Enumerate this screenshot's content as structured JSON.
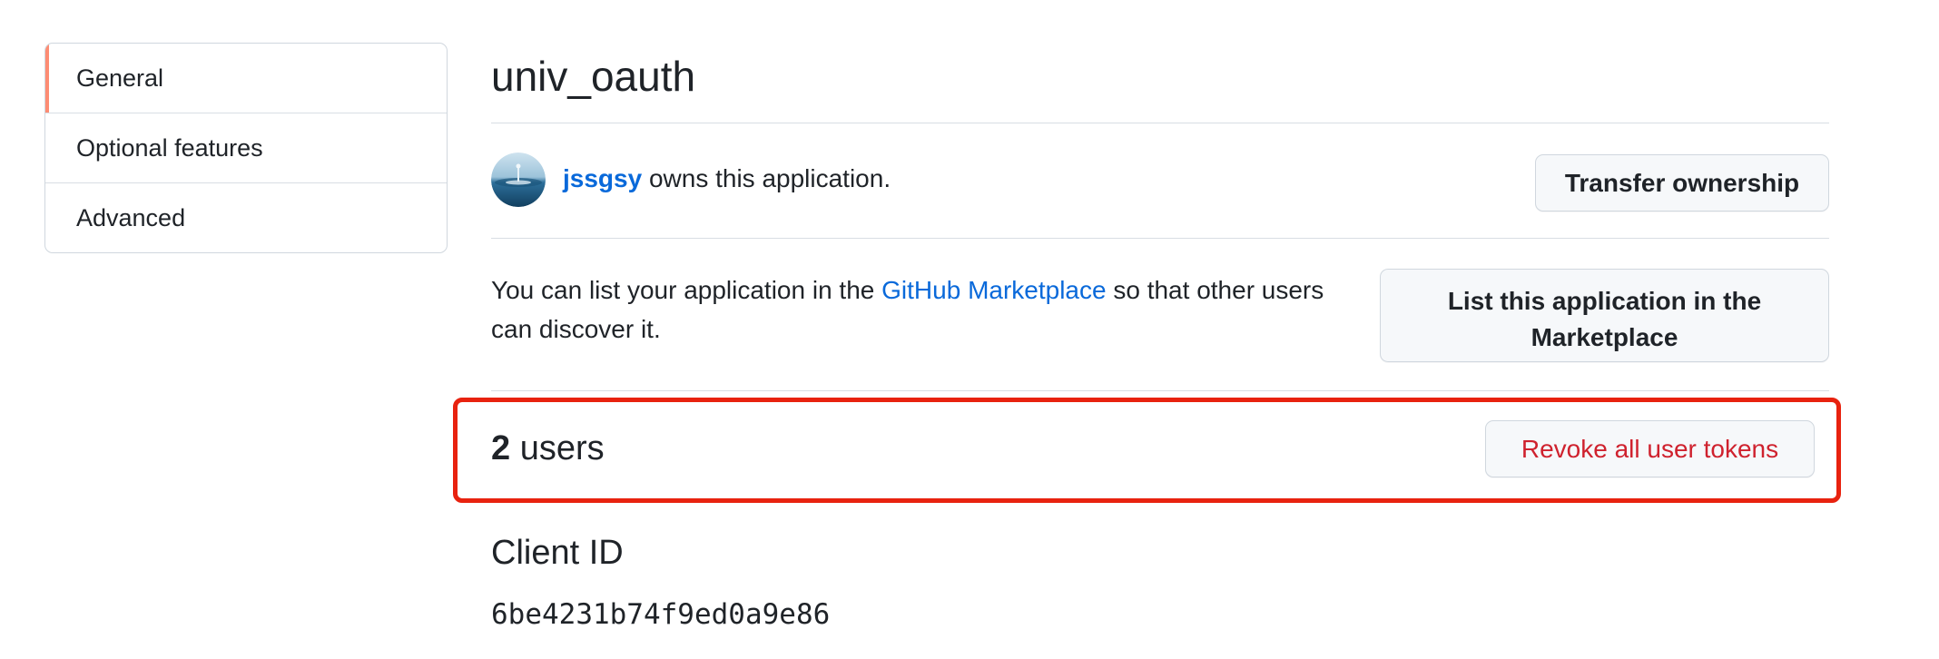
{
  "sidebar": {
    "items": [
      {
        "label": "General",
        "selected": true
      },
      {
        "label": "Optional features",
        "selected": false
      },
      {
        "label": "Advanced",
        "selected": false
      }
    ]
  },
  "app": {
    "title": "univ_oauth"
  },
  "owner": {
    "username": "jssgsy",
    "suffix": " owns this application.",
    "transfer_button": "Transfer ownership"
  },
  "marketplace": {
    "text_before": "You can list your application in the ",
    "link_text": "GitHub Marketplace",
    "text_after": " so that other users can discover it.",
    "button": "List this application in the Marketplace"
  },
  "users": {
    "count": "2",
    "label": " users",
    "revoke_button": "Revoke all user tokens"
  },
  "client": {
    "heading": "Client ID",
    "id": "6be4231b74f9ed0a9e86"
  },
  "colors": {
    "link": "#0969da",
    "danger": "#cf222e",
    "selected_marker": "#fd8c73",
    "highlight_box": "#e8220f"
  }
}
